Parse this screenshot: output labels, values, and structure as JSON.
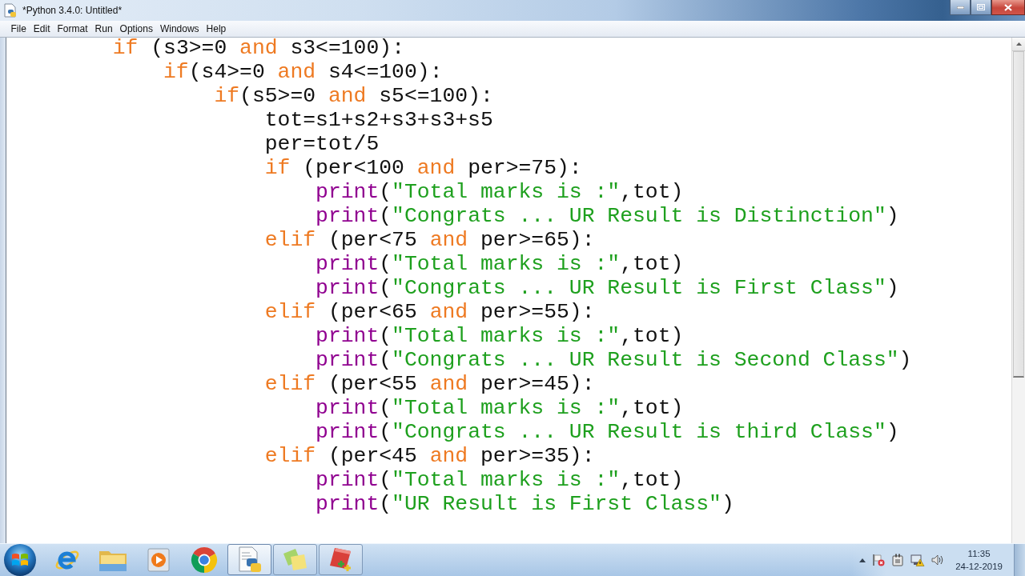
{
  "window": {
    "title": "*Python 3.4.0: Untitled*"
  },
  "menu": [
    "File",
    "Edit",
    "Format",
    "Run",
    "Options",
    "Windows",
    "Help"
  ],
  "editor": {
    "lines": [
      {
        "tokens": [
          {
            "kind": "keyword",
            "text": "if"
          },
          {
            "kind": "plain",
            "text": " (s3>=0 "
          },
          {
            "kind": "keyword",
            "text": "and"
          },
          {
            "kind": "plain",
            "text": " s3<=100):"
          }
        ],
        "children": [
          {
            "tokens": [
              {
                "kind": "keyword",
                "text": "if"
              },
              {
                "kind": "plain",
                "text": "(s4>=0 "
              },
              {
                "kind": "keyword",
                "text": "and"
              },
              {
                "kind": "plain",
                "text": " s4<=100):"
              }
            ],
            "children": [
              {
                "tokens": [
                  {
                    "kind": "keyword",
                    "text": "if"
                  },
                  {
                    "kind": "plain",
                    "text": "(s5>=0 "
                  },
                  {
                    "kind": "keyword",
                    "text": "and"
                  },
                  {
                    "kind": "plain",
                    "text": " s5<=100):"
                  }
                ],
                "children": [
                  {
                    "tokens": [
                      {
                        "kind": "plain",
                        "text": "tot=s1+s2+s3+s3+s5"
                      }
                    ]
                  },
                  {
                    "tokens": [
                      {
                        "kind": "plain",
                        "text": "per=tot/5"
                      }
                    ]
                  },
                  {
                    "tokens": [
                      {
                        "kind": "keyword",
                        "text": "if"
                      },
                      {
                        "kind": "plain",
                        "text": " (per<100 "
                      },
                      {
                        "kind": "keyword",
                        "text": "and"
                      },
                      {
                        "kind": "plain",
                        "text": " per>=75):"
                      }
                    ],
                    "children": [
                      {
                        "tokens": [
                          {
                            "kind": "builtin",
                            "text": "print"
                          },
                          {
                            "kind": "plain",
                            "text": "("
                          },
                          {
                            "kind": "string",
                            "text": "\"Total marks is :\""
                          },
                          {
                            "kind": "plain",
                            "text": ",tot)"
                          }
                        ]
                      },
                      {
                        "tokens": [
                          {
                            "kind": "builtin",
                            "text": "print"
                          },
                          {
                            "kind": "plain",
                            "text": "("
                          },
                          {
                            "kind": "string",
                            "text": "\"Congrats ... UR Result is Distinction\""
                          },
                          {
                            "kind": "plain",
                            "text": ")"
                          }
                        ]
                      }
                    ]
                  },
                  {
                    "tokens": [
                      {
                        "kind": "keyword",
                        "text": "elif"
                      },
                      {
                        "kind": "plain",
                        "text": " (per<75 "
                      },
                      {
                        "kind": "keyword",
                        "text": "and"
                      },
                      {
                        "kind": "plain",
                        "text": " per>=65):"
                      }
                    ],
                    "children": [
                      {
                        "tokens": [
                          {
                            "kind": "builtin",
                            "text": "print"
                          },
                          {
                            "kind": "plain",
                            "text": "("
                          },
                          {
                            "kind": "string",
                            "text": "\"Total marks is :\""
                          },
                          {
                            "kind": "plain",
                            "text": ",tot)"
                          }
                        ]
                      },
                      {
                        "tokens": [
                          {
                            "kind": "builtin",
                            "text": "print"
                          },
                          {
                            "kind": "plain",
                            "text": "("
                          },
                          {
                            "kind": "string",
                            "text": "\"Congrats ... UR Result is First Class\""
                          },
                          {
                            "kind": "plain",
                            "text": ")"
                          }
                        ]
                      }
                    ]
                  },
                  {
                    "tokens": [
                      {
                        "kind": "keyword",
                        "text": "elif"
                      },
                      {
                        "kind": "plain",
                        "text": " (per<65 "
                      },
                      {
                        "kind": "keyword",
                        "text": "and"
                      },
                      {
                        "kind": "plain",
                        "text": " per>=55):"
                      }
                    ],
                    "children": [
                      {
                        "tokens": [
                          {
                            "kind": "builtin",
                            "text": "print"
                          },
                          {
                            "kind": "plain",
                            "text": "("
                          },
                          {
                            "kind": "string",
                            "text": "\"Total marks is :\""
                          },
                          {
                            "kind": "plain",
                            "text": ",tot)"
                          }
                        ]
                      },
                      {
                        "tokens": [
                          {
                            "kind": "builtin",
                            "text": "print"
                          },
                          {
                            "kind": "plain",
                            "text": "("
                          },
                          {
                            "kind": "string",
                            "text": "\"Congrats ... UR Result is Second Class\""
                          },
                          {
                            "kind": "plain",
                            "text": ")"
                          }
                        ]
                      }
                    ]
                  },
                  {
                    "tokens": [
                      {
                        "kind": "keyword",
                        "text": "elif"
                      },
                      {
                        "kind": "plain",
                        "text": " (per<55 "
                      },
                      {
                        "kind": "keyword",
                        "text": "and"
                      },
                      {
                        "kind": "plain",
                        "text": " per>=45):"
                      }
                    ],
                    "children": [
                      {
                        "tokens": [
                          {
                            "kind": "builtin",
                            "text": "print"
                          },
                          {
                            "kind": "plain",
                            "text": "("
                          },
                          {
                            "kind": "string",
                            "text": "\"Total marks is :\""
                          },
                          {
                            "kind": "plain",
                            "text": ",tot)"
                          }
                        ]
                      },
                      {
                        "tokens": [
                          {
                            "kind": "builtin",
                            "text": "print"
                          },
                          {
                            "kind": "plain",
                            "text": "("
                          },
                          {
                            "kind": "string",
                            "text": "\"Congrats ... UR Result is third Class\""
                          },
                          {
                            "kind": "plain",
                            "text": ")"
                          }
                        ]
                      }
                    ]
                  },
                  {
                    "tokens": [
                      {
                        "kind": "keyword",
                        "text": "elif"
                      },
                      {
                        "kind": "plain",
                        "text": " (per<45 "
                      },
                      {
                        "kind": "keyword",
                        "text": "and"
                      },
                      {
                        "kind": "plain",
                        "text": " per>=35):"
                      }
                    ],
                    "children": [
                      {
                        "tokens": [
                          {
                            "kind": "builtin",
                            "text": "print"
                          },
                          {
                            "kind": "plain",
                            "text": "("
                          },
                          {
                            "kind": "string",
                            "text": "\"Total marks is :\""
                          },
                          {
                            "kind": "plain",
                            "text": ",tot)"
                          }
                        ]
                      },
                      {
                        "tokens": [
                          {
                            "kind": "builtin",
                            "text": "print"
                          },
                          {
                            "kind": "plain",
                            "text": "("
                          },
                          {
                            "kind": "string",
                            "text": "\"UR Result is First Class\""
                          },
                          {
                            "kind": "plain",
                            "text": ")"
                          }
                        ]
                      }
                    ]
                  }
                ]
              }
            ]
          }
        ]
      }
    ]
  },
  "taskbar": {
    "buttons": [
      {
        "kind": "e-browser",
        "running": false,
        "selected": false
      },
      {
        "kind": "folder",
        "running": false,
        "selected": false
      },
      {
        "kind": "player",
        "running": false,
        "selected": false
      },
      {
        "kind": "circle-browser",
        "running": false,
        "selected": false
      },
      {
        "kind": "python",
        "running": true,
        "selected": true
      },
      {
        "kind": "notes",
        "running": true,
        "selected": false
      },
      {
        "kind": "notebook",
        "running": true,
        "selected": false
      }
    ],
    "clock": {
      "time": "11:35",
      "date": "24-12-2019"
    }
  }
}
